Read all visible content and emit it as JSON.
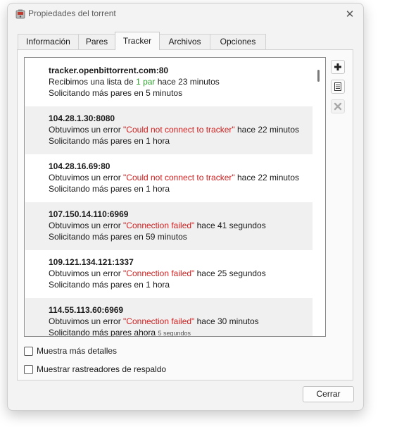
{
  "window": {
    "title": "Propiedades del torrent",
    "app_icon": "transmission-icon",
    "close_glyph": "✕"
  },
  "tabs": [
    {
      "label": "Información"
    },
    {
      "label": "Pares"
    },
    {
      "label": "Tracker",
      "active": true
    },
    {
      "label": "Archivos"
    },
    {
      "label": "Opciones"
    }
  ],
  "trackers": [
    {
      "host": "tracker.openbittorrent.com:80",
      "line1": {
        "pre": "Recibimos una lista de ",
        "hl": "1 par",
        "post": " hace 23 minutos"
      },
      "line2": "Solicitando más pares en 5 minutos"
    },
    {
      "host": "104.28.1.30:8080",
      "line1": {
        "pre": "Obtuvimos un error ",
        "hl": "\"Could not connect to tracker\"",
        "post": " hace 22 minutos"
      },
      "line2": "Solicitando más pares en 1 hora"
    },
    {
      "host": "104.28.16.69:80",
      "line1": {
        "pre": "Obtuvimos un error ",
        "hl": "\"Could not connect to tracker\"",
        "post": " hace 22 minutos"
      },
      "line2": "Solicitando más pares en 1 hora"
    },
    {
      "host": "107.150.14.110:6969",
      "line1": {
        "pre": "Obtuvimos un error ",
        "hl": "\"Connection failed\"",
        "post": " hace 41 segundos"
      },
      "line2": "Solicitando más pares en 59 minutos"
    },
    {
      "host": "109.121.134.121:1337",
      "line1": {
        "pre": "Obtuvimos un error ",
        "hl": "\"Connection failed\"",
        "post": " hace 25 segundos"
      },
      "line2": "Solicitando más pares en 1 hora"
    },
    {
      "host": "114.55.113.60:6969",
      "line1": {
        "pre": "Obtuvimos un error ",
        "hl": "\"Connection failed\"",
        "post": " hace 30 minutos"
      },
      "line2": "Solicitando más pares ahora",
      "line2_extra": "5 segundos"
    }
  ],
  "side_buttons": {
    "add_icon": "plus-icon",
    "edit_icon": "list-icon",
    "remove_icon": "remove-icon"
  },
  "options": {
    "more_details": {
      "label": "Muestra más detalles",
      "checked": false
    },
    "backup_trackers": {
      "label": "Muestrar rastreadores de respaldo",
      "checked": false
    }
  },
  "close_button": "Cerrar",
  "colors": {
    "success": "#2e9e2e",
    "error": "#d21f1f",
    "alt_row": "#f0f0f0"
  }
}
